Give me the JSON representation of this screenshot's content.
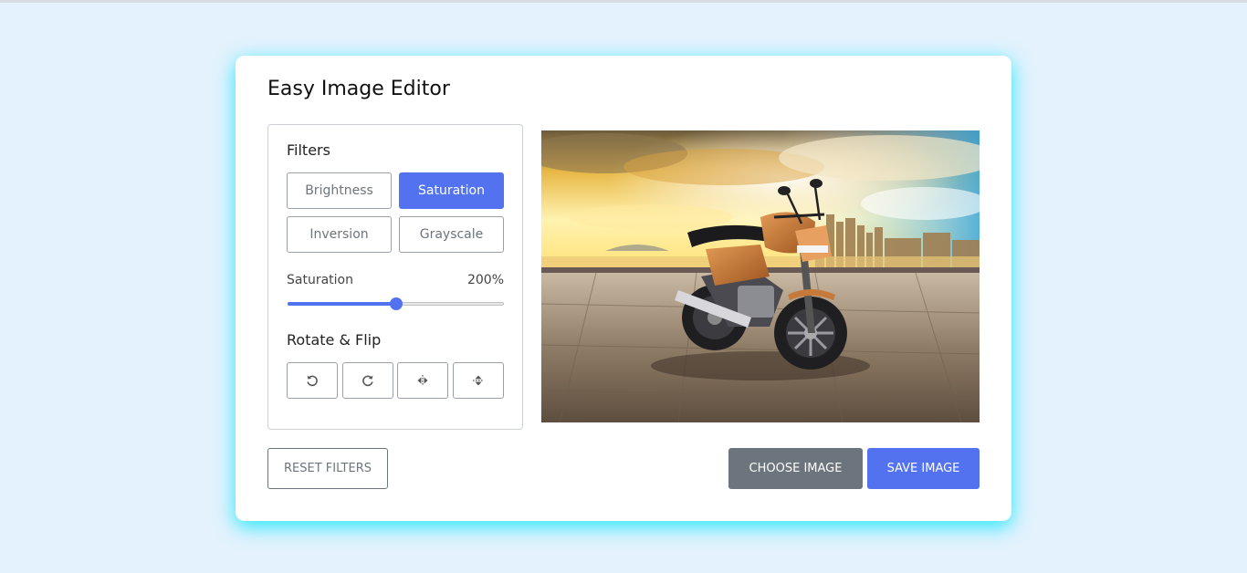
{
  "app": {
    "title": "Easy Image Editor"
  },
  "filters": {
    "label": "Filters",
    "buttons": [
      {
        "label": "Brightness",
        "active": false
      },
      {
        "label": "Saturation",
        "active": true
      },
      {
        "label": "Inversion",
        "active": false
      },
      {
        "label": "Grayscale",
        "active": false
      }
    ]
  },
  "slider": {
    "name": "Saturation",
    "value_text": "200%",
    "value": 200,
    "max": 400
  },
  "rotate_flip": {
    "label": "Rotate & Flip",
    "buttons": [
      {
        "icon": "rotate-left-icon"
      },
      {
        "icon": "rotate-right-icon"
      },
      {
        "icon": "flip-horizontal-icon"
      },
      {
        "icon": "flip-vertical-icon"
      }
    ]
  },
  "preview": {
    "subject": "orange motorcycle on stone plaza with city skyline at sunset"
  },
  "actions": {
    "reset_label": "RESET FILTERS",
    "choose_label": "CHOOSE IMAGE",
    "save_label": "SAVE IMAGE"
  },
  "colors": {
    "accent": "#5372f0",
    "secondary": "#6c757d",
    "background": "#e3f2fd",
    "glow": "#00e5ff"
  }
}
